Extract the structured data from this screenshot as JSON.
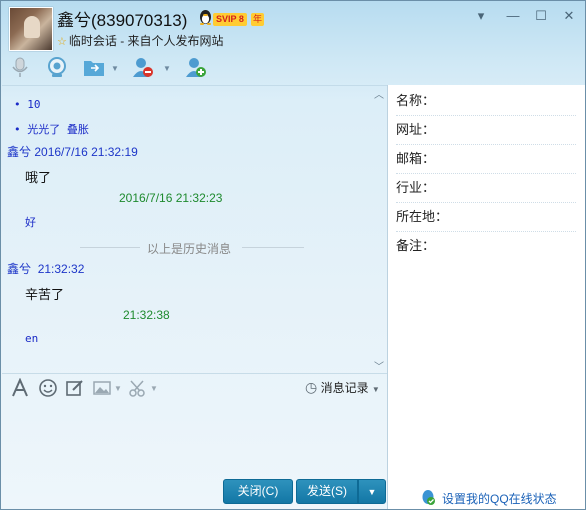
{
  "header": {
    "name": "鑫兮(839070313)",
    "vip_badge": "SVIP 8",
    "vip_year": "年",
    "subtitle": "临时会话 - 来自个人发布网站"
  },
  "toolbar": {
    "icons": [
      "microphone-icon",
      "video-camera-icon",
      "send-file-icon",
      "remove-contact-icon",
      "add-contact-icon"
    ]
  },
  "chat": {
    "lines": [
      {
        "kind": "bullet",
        "text": "• 10"
      },
      {
        "kind": "bullet",
        "text": "• 光光了  叠胀"
      },
      {
        "kind": "sender",
        "name": "鑫兮",
        "time": "2016/7/16 21:32:19"
      },
      {
        "kind": "text",
        "text": "哦了"
      },
      {
        "kind": "timestamp",
        "text": "2016/7/16 21:32:23"
      },
      {
        "kind": "small",
        "text": "好"
      },
      {
        "kind": "separator",
        "text": "以上是历史消息"
      },
      {
        "kind": "sender",
        "name": "鑫兮",
        "time": "21:32:32"
      },
      {
        "kind": "text",
        "text": "辛苦了"
      },
      {
        "kind": "timestamp",
        "text": "21:32:38"
      },
      {
        "kind": "small",
        "text": "en"
      }
    ]
  },
  "format_bar": {
    "history_label": "消息记录"
  },
  "buttons": {
    "close": "关闭(C)",
    "send": "发送(S)"
  },
  "side_panel": {
    "fields": [
      {
        "label": "名称："
      },
      {
        "label": "网址："
      },
      {
        "label": "邮箱："
      },
      {
        "label": "行业："
      },
      {
        "label": "所在地："
      },
      {
        "label": "备注："
      }
    ],
    "online_status_link": "设置我的QQ在线状态"
  },
  "colors": {
    "sender": "#1d36c8",
    "timestamp": "#1e8a2e",
    "button": "#1377a5"
  }
}
